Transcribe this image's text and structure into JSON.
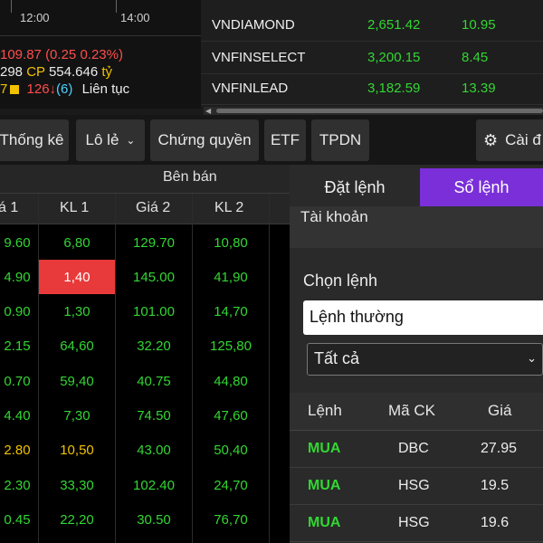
{
  "chart": {
    "time_ticks": [
      "12:00",
      "14:00"
    ],
    "index_value": "109.87",
    "index_change": "(0.25",
    "index_change_pct": "0.23%)",
    "volume": "298",
    "cp_label": "CP",
    "value": "554.646",
    "value_unit": "tỷ",
    "up_count": "7",
    "down_count": "126",
    "down_arrow": "↓",
    "unchanged_count": "(6)",
    "session_status": "Liên tục"
  },
  "indices": [
    {
      "name": "VNDIAMOND",
      "price": "2,651.42",
      "change": "10.95"
    },
    {
      "name": "VNFINSELECT",
      "price": "3,200.15",
      "change": "8.45"
    },
    {
      "name": "VNFINLEAD",
      "price": "3,182.59",
      "change": "13.39"
    }
  ],
  "toolbar": {
    "stats": "Thống kê",
    "odd_lot": "Lô lẻ",
    "warrants": "Chứng quyền",
    "etf": "ETF",
    "bonds": "TPDN",
    "settings": "Cài đ"
  },
  "board": {
    "group_header": "Bên bán",
    "columns": [
      "á 1",
      "KL 1",
      "Giá 2",
      "KL 2"
    ],
    "rows": [
      [
        "9.60",
        "6,80",
        "129.70",
        "10,80"
      ],
      [
        "4.90",
        "1,40",
        "145.00",
        "41,90"
      ],
      [
        "0.90",
        "1,30",
        "101.00",
        "14,70"
      ],
      [
        "2.15",
        "64,60",
        "32.20",
        "125,80"
      ],
      [
        "0.70",
        "59,40",
        "40.75",
        "44,80"
      ],
      [
        "4.40",
        "7,30",
        "74.50",
        "47,60"
      ],
      [
        "2.80",
        "10,50",
        "43.00",
        "50,40"
      ],
      [
        "2.30",
        "33,30",
        "102.40",
        "24,70"
      ],
      [
        "0.45",
        "22,20",
        "30.50",
        "76,70"
      ]
    ],
    "row_colors": [
      [
        "#33d633",
        "#33d633",
        "#33d633",
        "#33d633"
      ],
      [
        "#33d633",
        "#ffffff",
        "#33d633",
        "#33d633"
      ],
      [
        "#33d633",
        "#33d633",
        "#33d633",
        "#33d633"
      ],
      [
        "#33d633",
        "#33d633",
        "#33d633",
        "#33d633"
      ],
      [
        "#33d633",
        "#33d633",
        "#33d633",
        "#33d633"
      ],
      [
        "#33d633",
        "#33d633",
        "#33d633",
        "#33d633"
      ],
      [
        "#f2c200",
        "#f2c200",
        "#33d633",
        "#33d633"
      ],
      [
        "#33d633",
        "#33d633",
        "#33d633",
        "#33d633"
      ],
      [
        "#33d633",
        "#33d633",
        "#33d633",
        "#33d633"
      ]
    ]
  },
  "panel": {
    "tab_place": "Đặt lệnh",
    "tab_book": "Sổ lệnh",
    "account_label": "Tài khoản",
    "choose_order_label": "Chọn lệnh",
    "order_type_value": "Lệnh thường",
    "filter_value": "Tất cả",
    "headers": [
      "Lệnh",
      "Mã CK",
      "Giá"
    ],
    "orders": [
      {
        "side": "MUA",
        "symbol": "DBC",
        "price": "27.95"
      },
      {
        "side": "MUA",
        "symbol": "HSG",
        "price": "19.5"
      },
      {
        "side": "MUA",
        "symbol": "HSG",
        "price": "19.6"
      }
    ]
  },
  "colors": {
    "accent_purple": "#7a2fd8",
    "up_green": "#33d633",
    "down_red": "#ff4d4d",
    "ref_yellow": "#f2c200",
    "highlight_red": "#e83a3a"
  }
}
